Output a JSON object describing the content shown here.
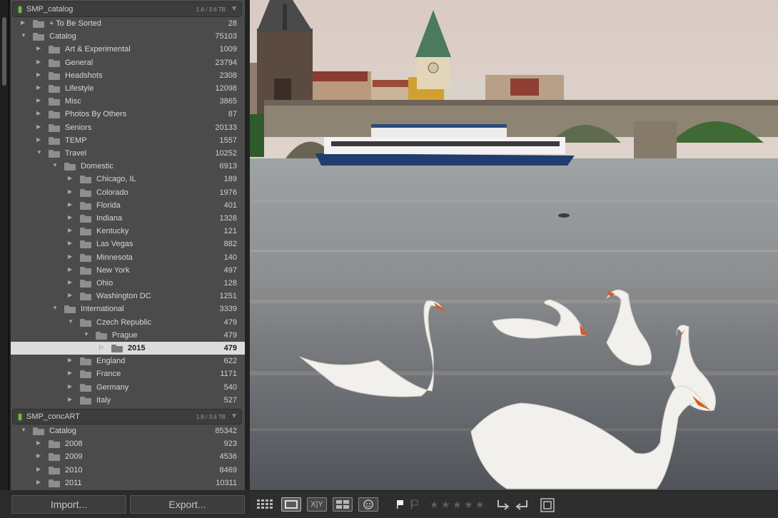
{
  "volumes": [
    {
      "name": "SMP_catalog",
      "size": "1.6 / 3.6 TB",
      "folders": [
        {
          "label": "+ To Be Sorted",
          "count": "28",
          "depth": 0,
          "expanded": false
        },
        {
          "label": "Catalog",
          "count": "75103",
          "depth": 0,
          "expanded": true
        },
        {
          "label": "Art & Experimental",
          "count": "1009",
          "depth": 1,
          "expanded": false
        },
        {
          "label": "General",
          "count": "23794",
          "depth": 1,
          "expanded": false
        },
        {
          "label": "Headshots",
          "count": "2308",
          "depth": 1,
          "expanded": false
        },
        {
          "label": "Lifestyle",
          "count": "12098",
          "depth": 1,
          "expanded": false
        },
        {
          "label": "Misc",
          "count": "3865",
          "depth": 1,
          "expanded": false
        },
        {
          "label": "Photos By Others",
          "count": "87",
          "depth": 1,
          "expanded": false
        },
        {
          "label": "Seniors",
          "count": "20133",
          "depth": 1,
          "expanded": false
        },
        {
          "label": "TEMP",
          "count": "1557",
          "depth": 1,
          "expanded": false
        },
        {
          "label": "Travel",
          "count": "10252",
          "depth": 1,
          "expanded": true
        },
        {
          "label": "Domestic",
          "count": "6913",
          "depth": 2,
          "expanded": true
        },
        {
          "label": "Chicago, IL",
          "count": "189",
          "depth": 3,
          "expanded": false
        },
        {
          "label": "Colorado",
          "count": "1976",
          "depth": 3,
          "expanded": false
        },
        {
          "label": "Florida",
          "count": "401",
          "depth": 3,
          "expanded": false
        },
        {
          "label": "Indiana",
          "count": "1328",
          "depth": 3,
          "expanded": false
        },
        {
          "label": "Kentucky",
          "count": "121",
          "depth": 3,
          "expanded": false
        },
        {
          "label": "Las Vegas",
          "count": "882",
          "depth": 3,
          "expanded": false
        },
        {
          "label": "Minnesota",
          "count": "140",
          "depth": 3,
          "expanded": false
        },
        {
          "label": "New York",
          "count": "497",
          "depth": 3,
          "expanded": false
        },
        {
          "label": "Ohio",
          "count": "128",
          "depth": 3,
          "expanded": false
        },
        {
          "label": "Washington DC",
          "count": "1251",
          "depth": 3,
          "expanded": false
        },
        {
          "label": "International",
          "count": "3339",
          "depth": 2,
          "expanded": true
        },
        {
          "label": "Czech Republic",
          "count": "479",
          "depth": 3,
          "expanded": true
        },
        {
          "label": "Prague",
          "count": "479",
          "depth": 4,
          "expanded": true
        },
        {
          "label": "2015",
          "count": "479",
          "depth": 5,
          "expanded": false,
          "selected": true
        },
        {
          "label": "England",
          "count": "622",
          "depth": 3,
          "expanded": false
        },
        {
          "label": "France",
          "count": "1171",
          "depth": 3,
          "expanded": false
        },
        {
          "label": "Germany",
          "count": "540",
          "depth": 3,
          "expanded": false
        },
        {
          "label": "Italy",
          "count": "527",
          "depth": 3,
          "expanded": false
        }
      ]
    },
    {
      "name": "SMP_concART",
      "size": "1.8 / 3.6 TB",
      "folders": [
        {
          "label": "Catalog",
          "count": "85342",
          "depth": 0,
          "expanded": true
        },
        {
          "label": "2008",
          "count": "923",
          "depth": 1,
          "expanded": false
        },
        {
          "label": "2009",
          "count": "4536",
          "depth": 1,
          "expanded": false
        },
        {
          "label": "2010",
          "count": "8469",
          "depth": 1,
          "expanded": false
        },
        {
          "label": "2011",
          "count": "10311",
          "depth": 1,
          "expanded": false
        }
      ]
    }
  ],
  "buttons": {
    "import": "Import...",
    "export": "Export..."
  },
  "toolbar": {
    "compare_label": "X|Y",
    "rating_stars": 0,
    "rating_max": 5
  },
  "colors": {
    "panel_bg": "#4b4b4b",
    "selected_row": "#dcdcdc",
    "volume_led": "#6fbf3f"
  }
}
